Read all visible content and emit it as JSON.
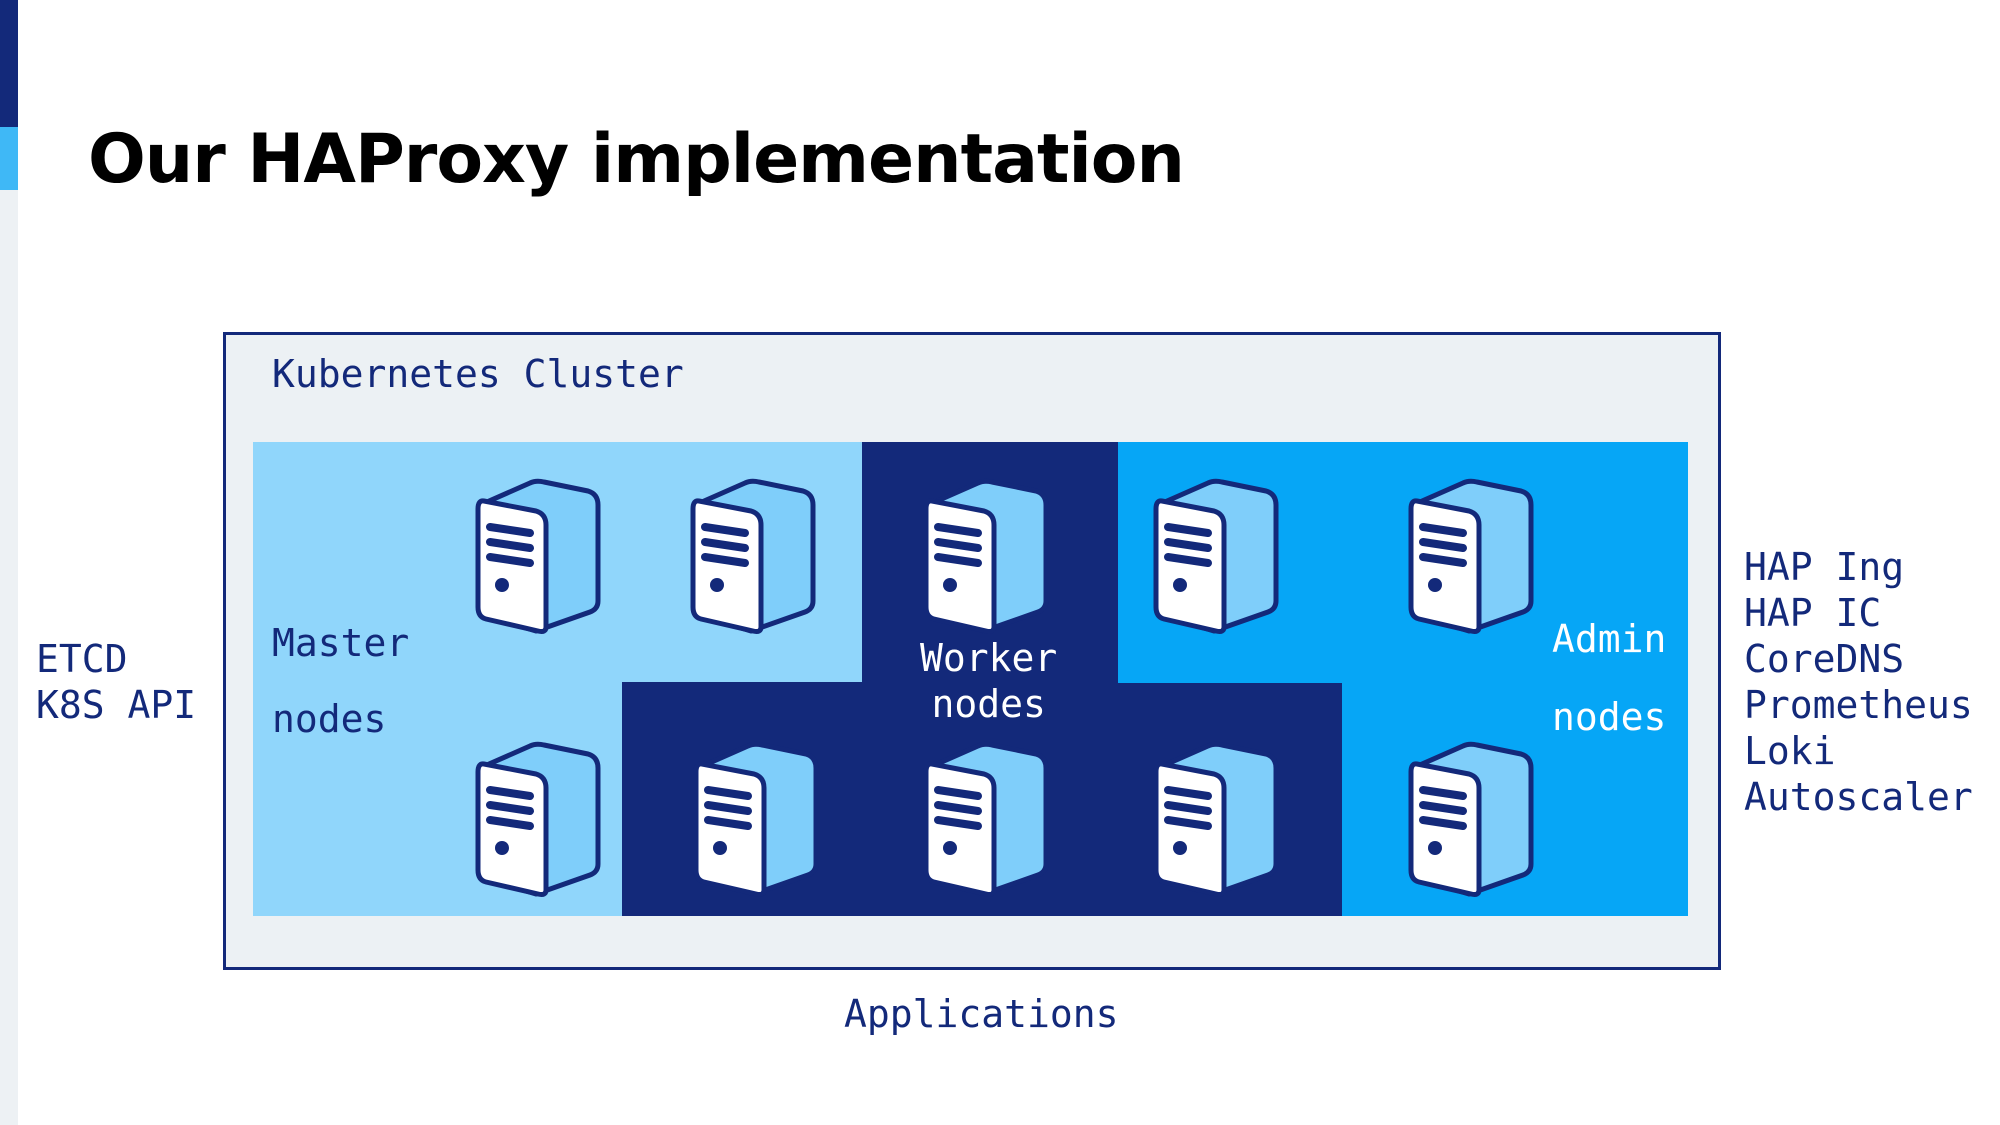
{
  "slide": {
    "title": "Our HAProxy implementation"
  },
  "colors": {
    "navy": "#13297a",
    "light_blue": "#90d6fb",
    "bright_blue": "#06a6f6",
    "panel_gray": "#ecf1f4",
    "server_side": "#7fcefa"
  },
  "diagram": {
    "cluster_label": "Kubernetes Cluster",
    "groups": {
      "master": {
        "line1": "Master",
        "line2": "nodes"
      },
      "worker": {
        "line1": "Worker",
        "line2": "nodes"
      },
      "admin": {
        "line1": "Admin",
        "line2": "nodes"
      }
    },
    "server_icon": "server-tower-icon",
    "left_labels": [
      "ETCD",
      "K8S API"
    ],
    "right_labels": [
      "HAP Ing",
      "HAP IC",
      "CoreDNS",
      "Prometheus",
      "Loki",
      "Autoscaler"
    ],
    "bottom_label": "Applications"
  }
}
